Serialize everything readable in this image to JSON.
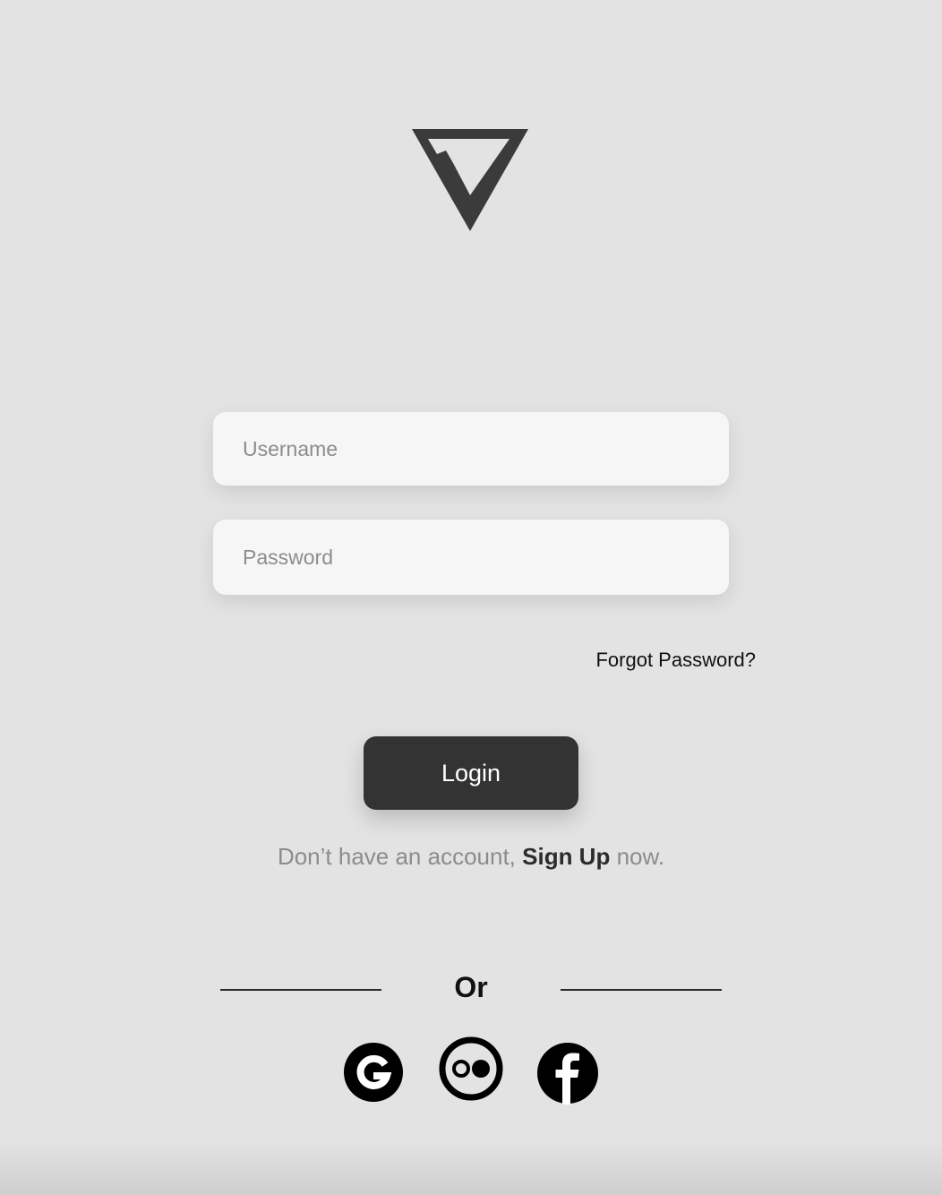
{
  "brand": {
    "logo_icon": "check-triangle-logo-icon"
  },
  "form": {
    "username_placeholder": "Username",
    "password_placeholder": "Password",
    "forgot_password_label": "Forgot Password?",
    "login_label": "Login"
  },
  "signup": {
    "prefix": "Don’t have an account, ",
    "link_label": "Sign Up",
    "suffix": " now."
  },
  "divider": {
    "label": "Or"
  },
  "social": [
    {
      "icon": "google-icon"
    },
    {
      "icon": "flickr-icon"
    },
    {
      "icon": "facebook-icon"
    }
  ],
  "colors": {
    "background": "#e3e3e3",
    "field_background": "#f6f6f6",
    "button_background": "#333333",
    "logo": "#3b3b3b",
    "muted_text": "#8c8c8c"
  }
}
